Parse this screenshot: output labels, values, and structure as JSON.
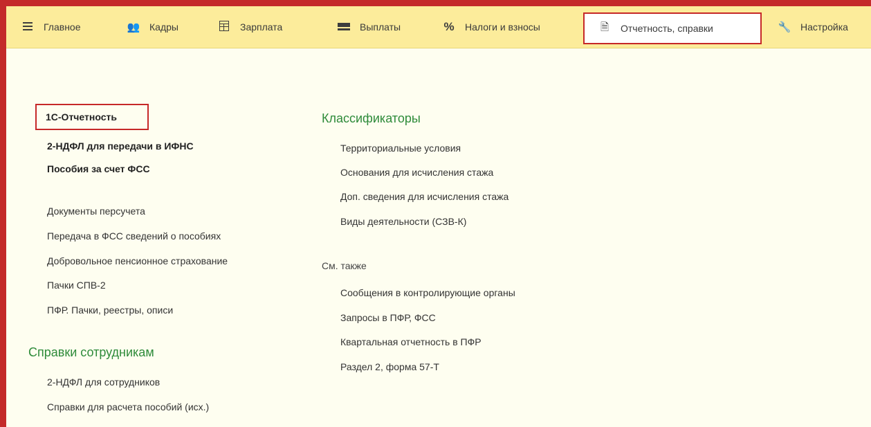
{
  "nav": {
    "items": [
      {
        "label": "Главное",
        "icon": "hamburger-menu-icon"
      },
      {
        "label": "Кадры",
        "icon": "people-icon"
      },
      {
        "label": "Зарплата",
        "icon": "calculator-icon"
      },
      {
        "label": "Выплаты",
        "icon": "wallet-icon"
      },
      {
        "label": "Налоги и взносы",
        "icon": "percent-icon"
      },
      {
        "label": "Отчетность, справки",
        "icon": "documents-icon"
      },
      {
        "label": "Настройка",
        "icon": "wrench-icon"
      }
    ],
    "active": "Отчетность, справки"
  },
  "reports": {
    "bold_links": [
      "1С-Отчетность",
      "2-НДФЛ для передачи в ИФНС",
      "Пособия за счет ФСС"
    ],
    "links": [
      "Документы персучета",
      "Передача в ФСС сведений о пособиях",
      "Добровольное пенсионное страхование",
      "Пачки СПВ-2",
      "ПФР. Пачки, реестры, описи"
    ]
  },
  "employee_certificates": {
    "title": "Справки сотрудникам",
    "links": [
      "2-НДФЛ для сотрудников",
      "Справки для расчета пособий (исх.)"
    ]
  },
  "classifiers": {
    "title": "Классификаторы",
    "links": [
      "Территориальные условия",
      "Основания для исчисления стажа",
      "Доп. сведения для исчисления стажа",
      "Виды деятельности (СЗВ-К)"
    ]
  },
  "see_also": {
    "title": "См. также",
    "links": [
      "Сообщения в контролирующие органы",
      "Запросы в ПФР, ФСС",
      "Квартальная отчетность в ПФР",
      "Раздел 2, форма 57-Т"
    ]
  },
  "colors": {
    "topbar_bg": "#fcec9b",
    "frame_red": "#c42a2a",
    "section_green": "#2e8b3a",
    "content_bg": "#fefef0"
  }
}
